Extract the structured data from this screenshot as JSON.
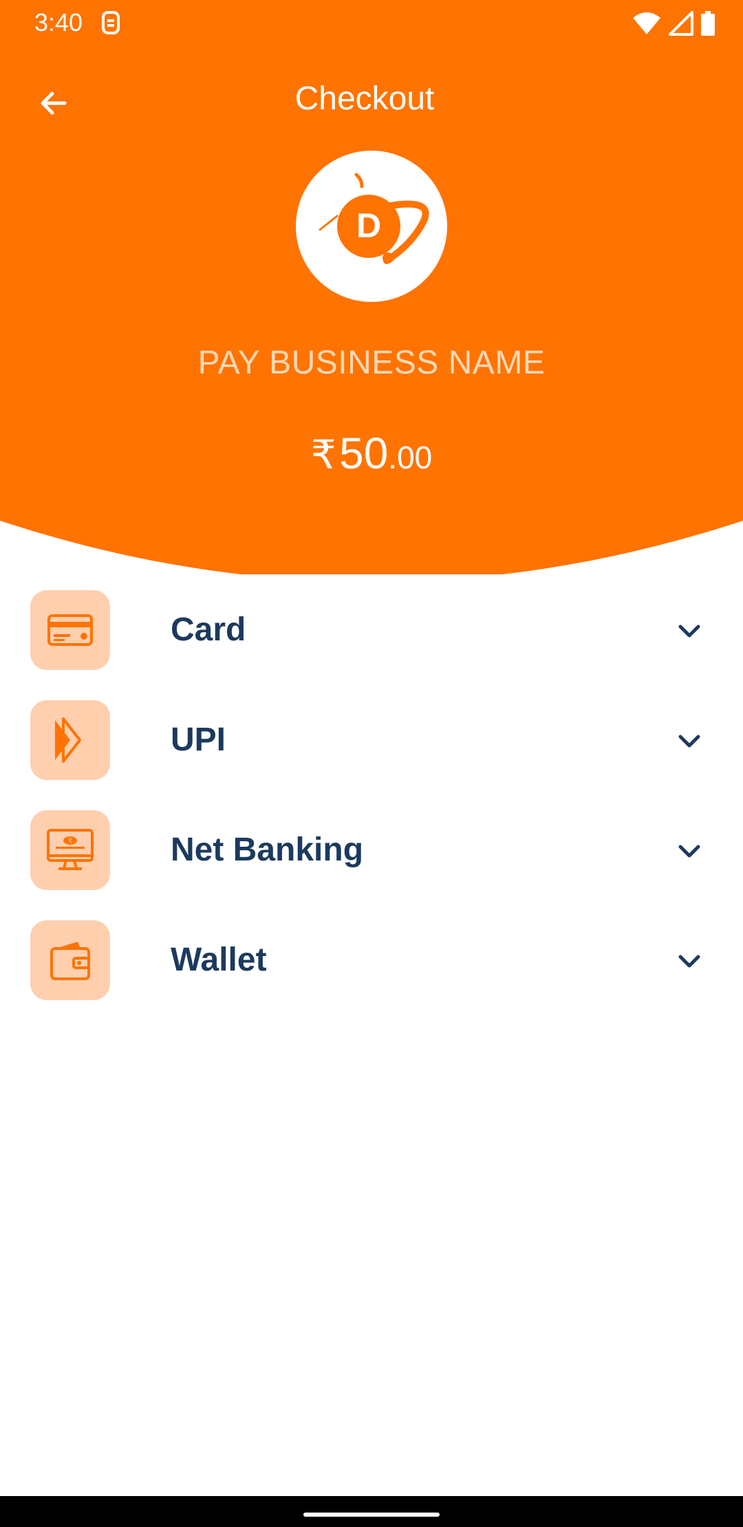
{
  "status_bar": {
    "time": "3:40"
  },
  "app_bar": {
    "title": "Checkout"
  },
  "merchant": {
    "logo_letter": "D",
    "business_name": "PAY BUSINESS NAME"
  },
  "amount": {
    "currency": "₹",
    "major": "50",
    "minor": ".00"
  },
  "payment_methods": [
    {
      "label": "Card",
      "icon": "credit-card-icon"
    },
    {
      "label": "UPI",
      "icon": "upi-icon"
    },
    {
      "label": "Net Banking",
      "icon": "net-banking-icon"
    },
    {
      "label": "Wallet",
      "icon": "wallet-icon"
    }
  ],
  "colors": {
    "brand_orange": "#ff7300",
    "icon_bg": "#ffcfae",
    "label_navy": "#1c3a5e",
    "business_name": "#ffd9b8"
  }
}
